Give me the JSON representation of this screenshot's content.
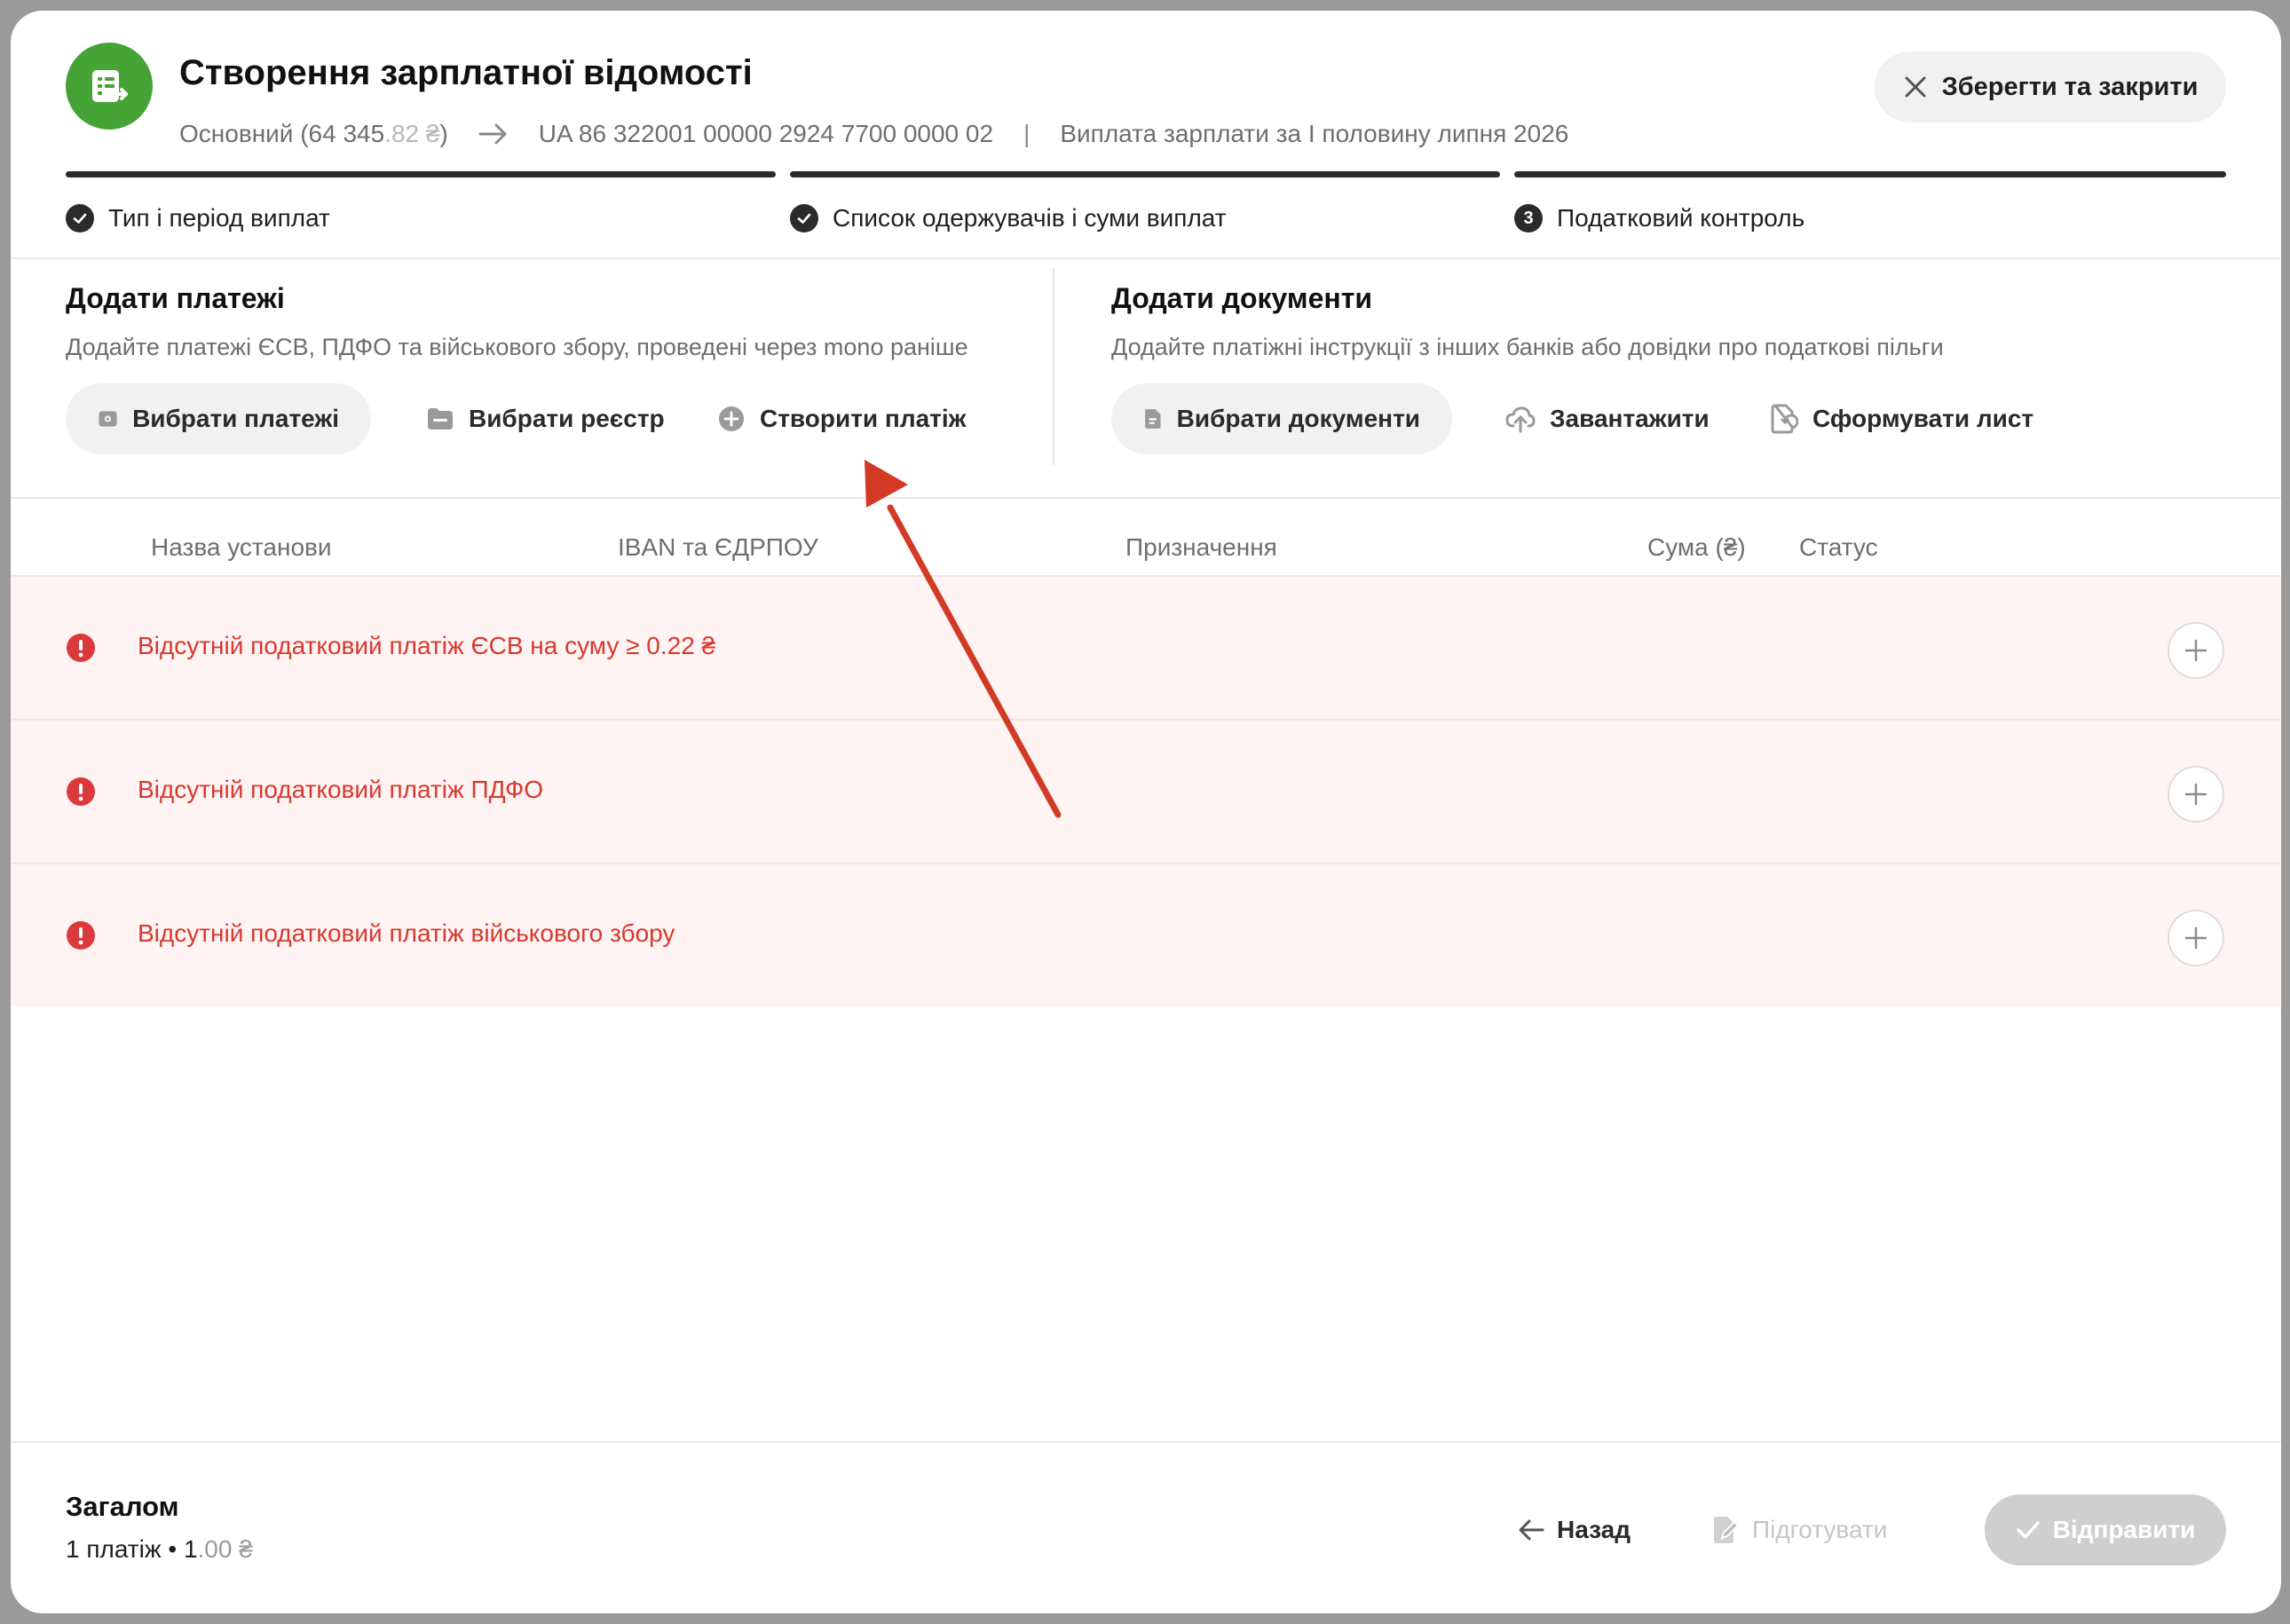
{
  "header": {
    "title": "Створення зарплатної відомості",
    "account_prefix": "Основний (64 345",
    "account_cents": ".82 ₴",
    "account_suffix": ")",
    "iban": "UA 86 322001 00000 2924 7700 0000 02",
    "separator": "|",
    "purpose": "Виплата зарплати за I половину липня 2026",
    "save_close_label": "Зберегти та закрити"
  },
  "steps": [
    {
      "label": "Тип і період виплат",
      "state": "done"
    },
    {
      "label": "Список одержувачів і суми виплат",
      "state": "done"
    },
    {
      "label": "Податковий контроль",
      "state": "current",
      "number": "3"
    }
  ],
  "add_payments": {
    "title": "Додати платежі",
    "description": "Додайте платежі ЄСВ, ПДФО та військового збору, проведені через mono раніше",
    "buttons": {
      "select_payments": "Вибрати платежі",
      "select_registry": "Вибрати реєстр",
      "create_payment": "Створити платіж"
    }
  },
  "add_documents": {
    "title": "Додати документи",
    "description": "Додайте платіжні інструкції з інших банків або довідки про податкові пільги",
    "buttons": {
      "select_documents": "Вибрати документи",
      "upload": "Завантажити",
      "generate_letter": "Сформувати лист"
    }
  },
  "table": {
    "columns": [
      "Назва установи",
      "IBAN та ЄДРПОУ",
      "Призначення",
      "Сума (₴)",
      "Статус"
    ],
    "rows": [
      {
        "message": "Відсутній податковий платіж ЄСВ на суму ≥ 0.22 ₴"
      },
      {
        "message": "Відсутній податковий платіж ПДФО"
      },
      {
        "message": "Відсутній податковий платіж військового збору"
      }
    ]
  },
  "footer": {
    "total_label": "Загалом",
    "summary_prefix": "1 платіж • 1",
    "summary_cents": ".00 ₴",
    "back_label": "Назад",
    "prepare_label": "Підготувати",
    "send_label": "Відправити"
  },
  "colors": {
    "brand_green": "#46a335",
    "error_red": "#d7392e",
    "error_row_bg": "#fff4f3",
    "annotation_arrow": "#d23a24"
  }
}
